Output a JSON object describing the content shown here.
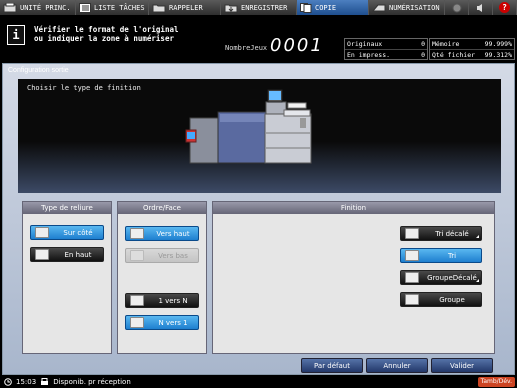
{
  "tabs": [
    {
      "label": "UNITÉ PRINC.",
      "icon": "home-icon"
    },
    {
      "label": "LISTE TÂCHES",
      "icon": "list-icon"
    },
    {
      "label": "RAPPELER",
      "icon": "folder-icon"
    },
    {
      "label": "ENREGISTRER",
      "icon": "save-icon"
    },
    {
      "label": "COPIE",
      "icon": "copy-icon"
    },
    {
      "label": "NUMÉRISATION",
      "icon": "scan-icon"
    }
  ],
  "message": {
    "line1": "Vérifier le format de l'original",
    "line2": "ou indiquer la zone à numériser"
  },
  "counter": {
    "label": "NombreJeux",
    "value": "0001"
  },
  "stats": {
    "originaux_label": "Originaux",
    "originaux_value": "0",
    "impress_label": "En impress.",
    "impress_value": "0",
    "memoire_label": "Mémoire",
    "memoire_value": "99.999%",
    "qte_label": "Qté fichier",
    "qte_value": "99.312%"
  },
  "screen_title": "Configuration sortie",
  "preview_title": "Choisir le type de finition",
  "panels": {
    "reliure": {
      "title": "Type de reliure",
      "sur_cote": "Sur côté",
      "en_haut": "En haut"
    },
    "ordre": {
      "title": "Ordre/Face",
      "vers_haut": "Vers haut",
      "vers_bas": "Vers bas",
      "un_vers_n": "1 vers N",
      "n_vers_un": "N vers 1"
    },
    "finition": {
      "title": "Finition",
      "tri_decale": "Tri décalé",
      "tri": "Tri",
      "groupe_decale": "GroupeDécalé",
      "groupe": "Groupe"
    }
  },
  "bottom": {
    "par_defaut": "Par défaut",
    "annuler": "Annuler",
    "valider": "Valider"
  },
  "statusbar": {
    "time": "15:03",
    "status": "Disponib. pr réception",
    "tamb": "Tamb/Dév."
  }
}
